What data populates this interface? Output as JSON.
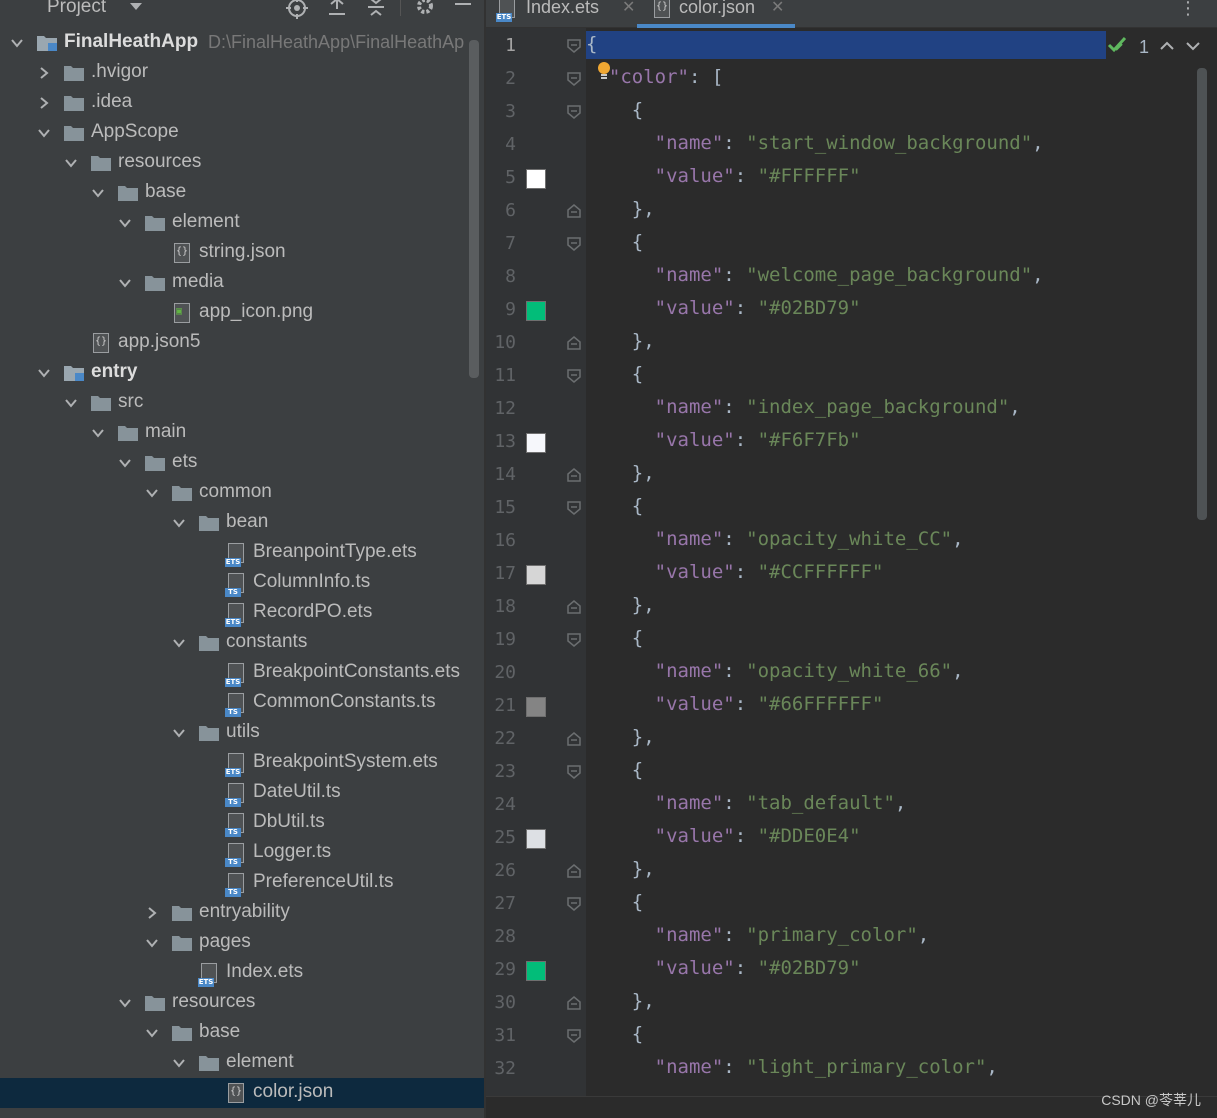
{
  "project_panel": {
    "title": "Project",
    "toolbar_icons": [
      "locate-icon",
      "expand-all-icon",
      "collapse-all-icon",
      "settings-icon",
      "hide-icon"
    ],
    "tree": [
      {
        "label": "FinalHeathApp",
        "path": "D:\\FinalHeathApp\\FinalHeathAp",
        "depth": 0,
        "expanded": true,
        "type": "module",
        "bold": true
      },
      {
        "label": ".hvigor",
        "depth": 1,
        "expanded": false,
        "type": "folder"
      },
      {
        "label": ".idea",
        "depth": 1,
        "expanded": false,
        "type": "folder"
      },
      {
        "label": "AppScope",
        "depth": 1,
        "expanded": true,
        "type": "folder"
      },
      {
        "label": "resources",
        "depth": 2,
        "expanded": true,
        "type": "folder"
      },
      {
        "label": "base",
        "depth": 3,
        "expanded": true,
        "type": "folder"
      },
      {
        "label": "element",
        "depth": 4,
        "expanded": true,
        "type": "folder"
      },
      {
        "label": "string.json",
        "depth": 5,
        "type": "json"
      },
      {
        "label": "media",
        "depth": 4,
        "expanded": true,
        "type": "folder"
      },
      {
        "label": "app_icon.png",
        "depth": 5,
        "type": "image"
      },
      {
        "label": "app.json5",
        "depth": 2,
        "type": "json"
      },
      {
        "label": "entry",
        "depth": 1,
        "expanded": true,
        "type": "module",
        "bold": true
      },
      {
        "label": "src",
        "depth": 2,
        "expanded": true,
        "type": "folder"
      },
      {
        "label": "main",
        "depth": 3,
        "expanded": true,
        "type": "folder"
      },
      {
        "label": "ets",
        "depth": 4,
        "expanded": true,
        "type": "folder"
      },
      {
        "label": "common",
        "depth": 5,
        "expanded": true,
        "type": "folder"
      },
      {
        "label": "bean",
        "depth": 6,
        "expanded": true,
        "type": "folder"
      },
      {
        "label": "BreanpointType.ets",
        "depth": 7,
        "type": "ets"
      },
      {
        "label": "ColumnInfo.ts",
        "depth": 7,
        "type": "ts"
      },
      {
        "label": "RecordPO.ets",
        "depth": 7,
        "type": "ets"
      },
      {
        "label": "constants",
        "depth": 6,
        "expanded": true,
        "type": "folder"
      },
      {
        "label": "BreakpointConstants.ets",
        "depth": 7,
        "type": "ets"
      },
      {
        "label": "CommonConstants.ts",
        "depth": 7,
        "type": "ts"
      },
      {
        "label": "utils",
        "depth": 6,
        "expanded": true,
        "type": "folder"
      },
      {
        "label": "BreakpointSystem.ets",
        "depth": 7,
        "type": "ets"
      },
      {
        "label": "DateUtil.ts",
        "depth": 7,
        "type": "ts"
      },
      {
        "label": "DbUtil.ts",
        "depth": 7,
        "type": "ts"
      },
      {
        "label": "Logger.ts",
        "depth": 7,
        "type": "ts"
      },
      {
        "label": "PreferenceUtil.ts",
        "depth": 7,
        "type": "ts"
      },
      {
        "label": "entryability",
        "depth": 5,
        "expanded": false,
        "type": "folder"
      },
      {
        "label": "pages",
        "depth": 5,
        "expanded": true,
        "type": "folder"
      },
      {
        "label": "Index.ets",
        "depth": 6,
        "type": "ets"
      },
      {
        "label": "resources",
        "depth": 4,
        "expanded": true,
        "type": "folder"
      },
      {
        "label": "base",
        "depth": 5,
        "expanded": true,
        "type": "folder"
      },
      {
        "label": "element",
        "depth": 6,
        "expanded": true,
        "type": "folder"
      },
      {
        "label": "color.json",
        "depth": 7,
        "type": "json",
        "selected": true
      }
    ]
  },
  "editor": {
    "tabs": [
      {
        "label": "Index.ets",
        "icon": "ets-file-icon",
        "active": false
      },
      {
        "label": "color.json",
        "icon": "json-file-icon",
        "active": true
      }
    ],
    "inspection": {
      "count": "1"
    },
    "lines": [
      {
        "n": "1",
        "tokens": [
          [
            "p",
            "{"
          ]
        ]
      },
      {
        "n": "2",
        "tokens": [
          [
            "p",
            "  "
          ],
          [
            "k",
            "\"color\""
          ],
          [
            "p",
            ": ["
          ]
        ]
      },
      {
        "n": "3",
        "tokens": [
          [
            "p",
            "    {"
          ]
        ]
      },
      {
        "n": "4",
        "tokens": [
          [
            "p",
            "      "
          ],
          [
            "k",
            "\"name\""
          ],
          [
            "p",
            ": "
          ],
          [
            "s",
            "\"start_window_background\""
          ],
          [
            "p",
            ","
          ]
        ]
      },
      {
        "n": "5",
        "tokens": [
          [
            "p",
            "      "
          ],
          [
            "k",
            "\"value\""
          ],
          [
            "p",
            ": "
          ],
          [
            "s",
            "\"#FFFFFF\""
          ]
        ],
        "swatch": "#FFFFFF"
      },
      {
        "n": "6",
        "tokens": [
          [
            "p",
            "    },"
          ]
        ]
      },
      {
        "n": "7",
        "tokens": [
          [
            "p",
            "    {"
          ]
        ]
      },
      {
        "n": "8",
        "tokens": [
          [
            "p",
            "      "
          ],
          [
            "k",
            "\"name\""
          ],
          [
            "p",
            ": "
          ],
          [
            "s",
            "\"welcome_page_background\""
          ],
          [
            "p",
            ","
          ]
        ]
      },
      {
        "n": "9",
        "tokens": [
          [
            "p",
            "      "
          ],
          [
            "k",
            "\"value\""
          ],
          [
            "p",
            ": "
          ],
          [
            "s",
            "\"#02BD79\""
          ]
        ],
        "swatch": "#02BD79"
      },
      {
        "n": "10",
        "tokens": [
          [
            "p",
            "    },"
          ]
        ]
      },
      {
        "n": "11",
        "tokens": [
          [
            "p",
            "    {"
          ]
        ]
      },
      {
        "n": "12",
        "tokens": [
          [
            "p",
            "      "
          ],
          [
            "k",
            "\"name\""
          ],
          [
            "p",
            ": "
          ],
          [
            "s",
            "\"index_page_background\""
          ],
          [
            "p",
            ","
          ]
        ]
      },
      {
        "n": "13",
        "tokens": [
          [
            "p",
            "      "
          ],
          [
            "k",
            "\"value\""
          ],
          [
            "p",
            ": "
          ],
          [
            "s",
            "\"#F6F7Fb\""
          ]
        ],
        "swatch": "#F6F7FB"
      },
      {
        "n": "14",
        "tokens": [
          [
            "p",
            "    },"
          ]
        ]
      },
      {
        "n": "15",
        "tokens": [
          [
            "p",
            "    {"
          ]
        ]
      },
      {
        "n": "16",
        "tokens": [
          [
            "p",
            "      "
          ],
          [
            "k",
            "\"name\""
          ],
          [
            "p",
            ": "
          ],
          [
            "s",
            "\"opacity_white_CC\""
          ],
          [
            "p",
            ","
          ]
        ]
      },
      {
        "n": "17",
        "tokens": [
          [
            "p",
            "      "
          ],
          [
            "k",
            "\"value\""
          ],
          [
            "p",
            ": "
          ],
          [
            "s",
            "\"#CCFFFFFF\""
          ]
        ],
        "swatch": "#D6D6D6"
      },
      {
        "n": "18",
        "tokens": [
          [
            "p",
            "    },"
          ]
        ]
      },
      {
        "n": "19",
        "tokens": [
          [
            "p",
            "    {"
          ]
        ]
      },
      {
        "n": "20",
        "tokens": [
          [
            "p",
            "      "
          ],
          [
            "k",
            "\"name\""
          ],
          [
            "p",
            ": "
          ],
          [
            "s",
            "\"opacity_white_66\""
          ],
          [
            "p",
            ","
          ]
        ]
      },
      {
        "n": "21",
        "tokens": [
          [
            "p",
            "      "
          ],
          [
            "k",
            "\"value\""
          ],
          [
            "p",
            ": "
          ],
          [
            "s",
            "\"#66FFFFFF\""
          ]
        ],
        "swatch": "#848484"
      },
      {
        "n": "22",
        "tokens": [
          [
            "p",
            "    },"
          ]
        ]
      },
      {
        "n": "23",
        "tokens": [
          [
            "p",
            "    {"
          ]
        ]
      },
      {
        "n": "24",
        "tokens": [
          [
            "p",
            "      "
          ],
          [
            "k",
            "\"name\""
          ],
          [
            "p",
            ": "
          ],
          [
            "s",
            "\"tab_default\""
          ],
          [
            "p",
            ","
          ]
        ]
      },
      {
        "n": "25",
        "tokens": [
          [
            "p",
            "      "
          ],
          [
            "k",
            "\"value\""
          ],
          [
            "p",
            ": "
          ],
          [
            "s",
            "\"#DDE0E4\""
          ]
        ],
        "swatch": "#DDE0E4"
      },
      {
        "n": "26",
        "tokens": [
          [
            "p",
            "    },"
          ]
        ]
      },
      {
        "n": "27",
        "tokens": [
          [
            "p",
            "    {"
          ]
        ]
      },
      {
        "n": "28",
        "tokens": [
          [
            "p",
            "      "
          ],
          [
            "k",
            "\"name\""
          ],
          [
            "p",
            ": "
          ],
          [
            "s",
            "\"primary_color\""
          ],
          [
            "p",
            ","
          ]
        ]
      },
      {
        "n": "29",
        "tokens": [
          [
            "p",
            "      "
          ],
          [
            "k",
            "\"value\""
          ],
          [
            "p",
            ": "
          ],
          [
            "s",
            "\"#02BD79\""
          ]
        ],
        "swatch": "#02BD79"
      },
      {
        "n": "30",
        "tokens": [
          [
            "p",
            "    },"
          ]
        ]
      },
      {
        "n": "31",
        "tokens": [
          [
            "p",
            "    {"
          ]
        ]
      },
      {
        "n": "32",
        "tokens": [
          [
            "p",
            "      "
          ],
          [
            "k",
            "\"name\""
          ],
          [
            "p",
            ": "
          ],
          [
            "s",
            "\"light_primary_color\""
          ],
          [
            "p",
            ","
          ]
        ]
      }
    ]
  },
  "watermark": "CSDN @苓莘儿",
  "colors": {
    "panel_bg": "#3c3f41",
    "editor_bg": "#2b2b2b",
    "gutter_bg": "#313335",
    "selection_bg": "#0d293e",
    "current_line_bg": "#214283",
    "key": "#9876aa",
    "string": "#6a8759",
    "punct": "#a9b7c6",
    "accent": "#4a88c7"
  }
}
